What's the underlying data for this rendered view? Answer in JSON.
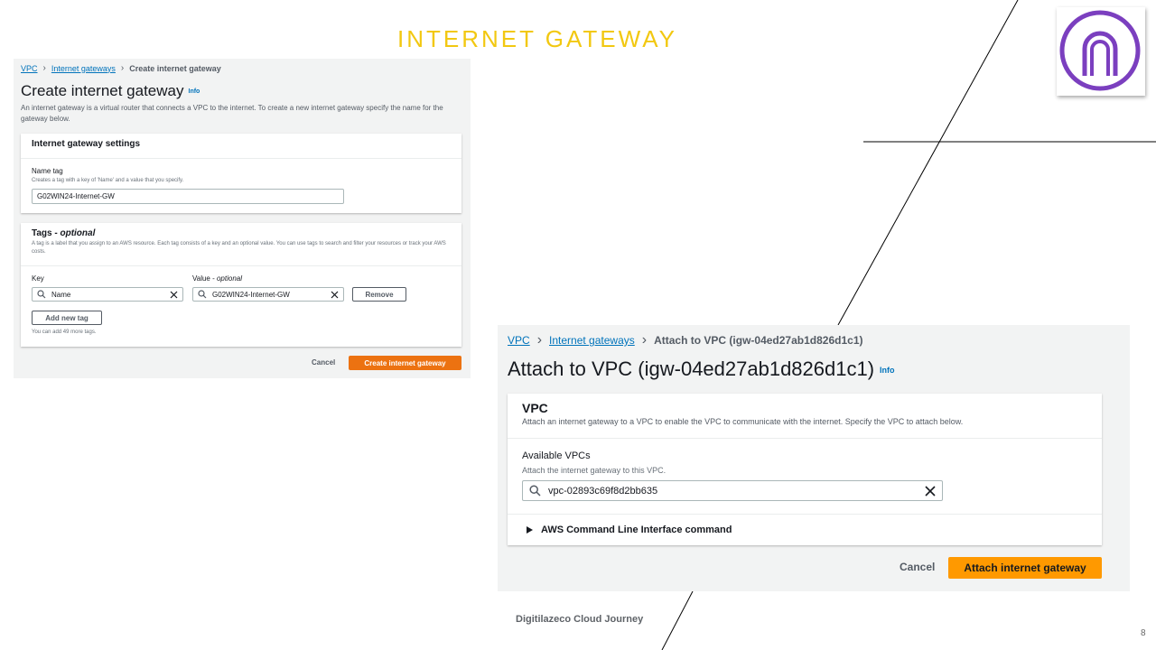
{
  "slide": {
    "title": "INTERNET GATEWAY",
    "footer": "Digitilazeco Cloud Journey",
    "page_number": "8",
    "accent_color": "#F2C811",
    "logo_icon": "arch-logo-icon"
  },
  "create_panel": {
    "breadcrumb": [
      "VPC",
      "Internet gateways",
      "Create internet gateway"
    ],
    "title": "Create internet gateway",
    "info": "Info",
    "description": "An internet gateway is a virtual router that connects a VPC to the internet. To create a new internet gateway specify the name for the gateway below.",
    "settings": {
      "header": "Internet gateway settings",
      "name_tag_label": "Name tag",
      "name_tag_hint": "Creates a tag with a key of 'Name' and a value that you specify.",
      "name_tag_value": "G02WIN24-Internet-GW"
    },
    "tags": {
      "header_prefix": "Tags - ",
      "header_optional": "optional",
      "description": "A tag is a label that you assign to an AWS resource. Each tag consists of a key and an optional value. You can use tags to search and filter your resources or track your AWS costs.",
      "key_label": "Key",
      "value_label_prefix": "Value - ",
      "value_label_optional": "optional",
      "key_value": "Name",
      "value_value": "G02WIN24-Internet-GW",
      "remove_label": "Remove",
      "add_label": "Add new tag",
      "limit_note": "You can add 49 more tags."
    },
    "cancel_label": "Cancel",
    "create_label": "Create internet gateway",
    "primary_color": "#EC7211"
  },
  "attach_panel": {
    "breadcrumb": [
      "VPC",
      "Internet gateways",
      "Attach to VPC (igw-04ed27ab1d826d1c1)"
    ],
    "title": "Attach to VPC (igw-04ed27ab1d826d1c1)",
    "info": "Info",
    "vpc_header": "VPC",
    "vpc_description": "Attach an internet gateway to a VPC to enable the VPC to communicate with the internet. Specify the VPC to attach below.",
    "available_label": "Available VPCs",
    "available_hint": "Attach the internet gateway to this VPC.",
    "vpc_value": "vpc-02893c69f8d2bb635",
    "cli_label": "AWS Command Line Interface command",
    "cancel_label": "Cancel",
    "attach_label": "Attach internet gateway",
    "primary_color": "#FF9900"
  }
}
